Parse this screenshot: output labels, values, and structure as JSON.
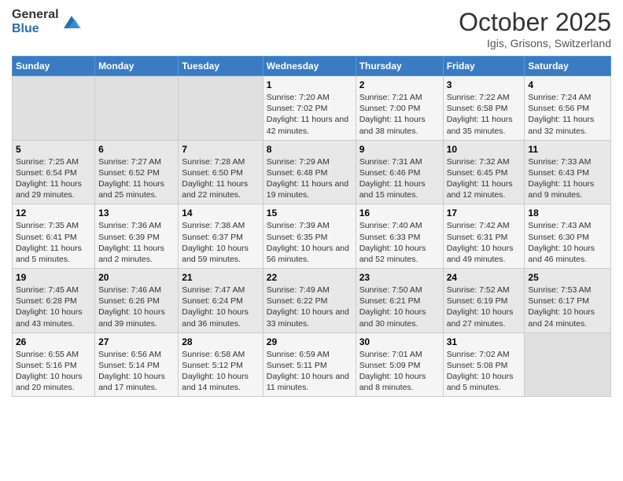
{
  "logo": {
    "general": "General",
    "blue": "Blue"
  },
  "header": {
    "month": "October 2025",
    "location": "Igis, Grisons, Switzerland"
  },
  "weekdays": [
    "Sunday",
    "Monday",
    "Tuesday",
    "Wednesday",
    "Thursday",
    "Friday",
    "Saturday"
  ],
  "weeks": [
    [
      {
        "day": "",
        "sunrise": "",
        "sunset": "",
        "daylight": ""
      },
      {
        "day": "",
        "sunrise": "",
        "sunset": "",
        "daylight": ""
      },
      {
        "day": "",
        "sunrise": "",
        "sunset": "",
        "daylight": ""
      },
      {
        "day": "1",
        "sunrise": "Sunrise: 7:20 AM",
        "sunset": "Sunset: 7:02 PM",
        "daylight": "Daylight: 11 hours and 42 minutes."
      },
      {
        "day": "2",
        "sunrise": "Sunrise: 7:21 AM",
        "sunset": "Sunset: 7:00 PM",
        "daylight": "Daylight: 11 hours and 38 minutes."
      },
      {
        "day": "3",
        "sunrise": "Sunrise: 7:22 AM",
        "sunset": "Sunset: 6:58 PM",
        "daylight": "Daylight: 11 hours and 35 minutes."
      },
      {
        "day": "4",
        "sunrise": "Sunrise: 7:24 AM",
        "sunset": "Sunset: 6:56 PM",
        "daylight": "Daylight: 11 hours and 32 minutes."
      }
    ],
    [
      {
        "day": "5",
        "sunrise": "Sunrise: 7:25 AM",
        "sunset": "Sunset: 6:54 PM",
        "daylight": "Daylight: 11 hours and 29 minutes."
      },
      {
        "day": "6",
        "sunrise": "Sunrise: 7:27 AM",
        "sunset": "Sunset: 6:52 PM",
        "daylight": "Daylight: 11 hours and 25 minutes."
      },
      {
        "day": "7",
        "sunrise": "Sunrise: 7:28 AM",
        "sunset": "Sunset: 6:50 PM",
        "daylight": "Daylight: 11 hours and 22 minutes."
      },
      {
        "day": "8",
        "sunrise": "Sunrise: 7:29 AM",
        "sunset": "Sunset: 6:48 PM",
        "daylight": "Daylight: 11 hours and 19 minutes."
      },
      {
        "day": "9",
        "sunrise": "Sunrise: 7:31 AM",
        "sunset": "Sunset: 6:46 PM",
        "daylight": "Daylight: 11 hours and 15 minutes."
      },
      {
        "day": "10",
        "sunrise": "Sunrise: 7:32 AM",
        "sunset": "Sunset: 6:45 PM",
        "daylight": "Daylight: 11 hours and 12 minutes."
      },
      {
        "day": "11",
        "sunrise": "Sunrise: 7:33 AM",
        "sunset": "Sunset: 6:43 PM",
        "daylight": "Daylight: 11 hours and 9 minutes."
      }
    ],
    [
      {
        "day": "12",
        "sunrise": "Sunrise: 7:35 AM",
        "sunset": "Sunset: 6:41 PM",
        "daylight": "Daylight: 11 hours and 5 minutes."
      },
      {
        "day": "13",
        "sunrise": "Sunrise: 7:36 AM",
        "sunset": "Sunset: 6:39 PM",
        "daylight": "Daylight: 11 hours and 2 minutes."
      },
      {
        "day": "14",
        "sunrise": "Sunrise: 7:38 AM",
        "sunset": "Sunset: 6:37 PM",
        "daylight": "Daylight: 10 hours and 59 minutes."
      },
      {
        "day": "15",
        "sunrise": "Sunrise: 7:39 AM",
        "sunset": "Sunset: 6:35 PM",
        "daylight": "Daylight: 10 hours and 56 minutes."
      },
      {
        "day": "16",
        "sunrise": "Sunrise: 7:40 AM",
        "sunset": "Sunset: 6:33 PM",
        "daylight": "Daylight: 10 hours and 52 minutes."
      },
      {
        "day": "17",
        "sunrise": "Sunrise: 7:42 AM",
        "sunset": "Sunset: 6:31 PM",
        "daylight": "Daylight: 10 hours and 49 minutes."
      },
      {
        "day": "18",
        "sunrise": "Sunrise: 7:43 AM",
        "sunset": "Sunset: 6:30 PM",
        "daylight": "Daylight: 10 hours and 46 minutes."
      }
    ],
    [
      {
        "day": "19",
        "sunrise": "Sunrise: 7:45 AM",
        "sunset": "Sunset: 6:28 PM",
        "daylight": "Daylight: 10 hours and 43 minutes."
      },
      {
        "day": "20",
        "sunrise": "Sunrise: 7:46 AM",
        "sunset": "Sunset: 6:26 PM",
        "daylight": "Daylight: 10 hours and 39 minutes."
      },
      {
        "day": "21",
        "sunrise": "Sunrise: 7:47 AM",
        "sunset": "Sunset: 6:24 PM",
        "daylight": "Daylight: 10 hours and 36 minutes."
      },
      {
        "day": "22",
        "sunrise": "Sunrise: 7:49 AM",
        "sunset": "Sunset: 6:22 PM",
        "daylight": "Daylight: 10 hours and 33 minutes."
      },
      {
        "day": "23",
        "sunrise": "Sunrise: 7:50 AM",
        "sunset": "Sunset: 6:21 PM",
        "daylight": "Daylight: 10 hours and 30 minutes."
      },
      {
        "day": "24",
        "sunrise": "Sunrise: 7:52 AM",
        "sunset": "Sunset: 6:19 PM",
        "daylight": "Daylight: 10 hours and 27 minutes."
      },
      {
        "day": "25",
        "sunrise": "Sunrise: 7:53 AM",
        "sunset": "Sunset: 6:17 PM",
        "daylight": "Daylight: 10 hours and 24 minutes."
      }
    ],
    [
      {
        "day": "26",
        "sunrise": "Sunrise: 6:55 AM",
        "sunset": "Sunset: 5:16 PM",
        "daylight": "Daylight: 10 hours and 20 minutes."
      },
      {
        "day": "27",
        "sunrise": "Sunrise: 6:56 AM",
        "sunset": "Sunset: 5:14 PM",
        "daylight": "Daylight: 10 hours and 17 minutes."
      },
      {
        "day": "28",
        "sunrise": "Sunrise: 6:58 AM",
        "sunset": "Sunset: 5:12 PM",
        "daylight": "Daylight: 10 hours and 14 minutes."
      },
      {
        "day": "29",
        "sunrise": "Sunrise: 6:59 AM",
        "sunset": "Sunset: 5:11 PM",
        "daylight": "Daylight: 10 hours and 11 minutes."
      },
      {
        "day": "30",
        "sunrise": "Sunrise: 7:01 AM",
        "sunset": "Sunset: 5:09 PM",
        "daylight": "Daylight: 10 hours and 8 minutes."
      },
      {
        "day": "31",
        "sunrise": "Sunrise: 7:02 AM",
        "sunset": "Sunset: 5:08 PM",
        "daylight": "Daylight: 10 hours and 5 minutes."
      },
      {
        "day": "",
        "sunrise": "",
        "sunset": "",
        "daylight": ""
      }
    ]
  ]
}
